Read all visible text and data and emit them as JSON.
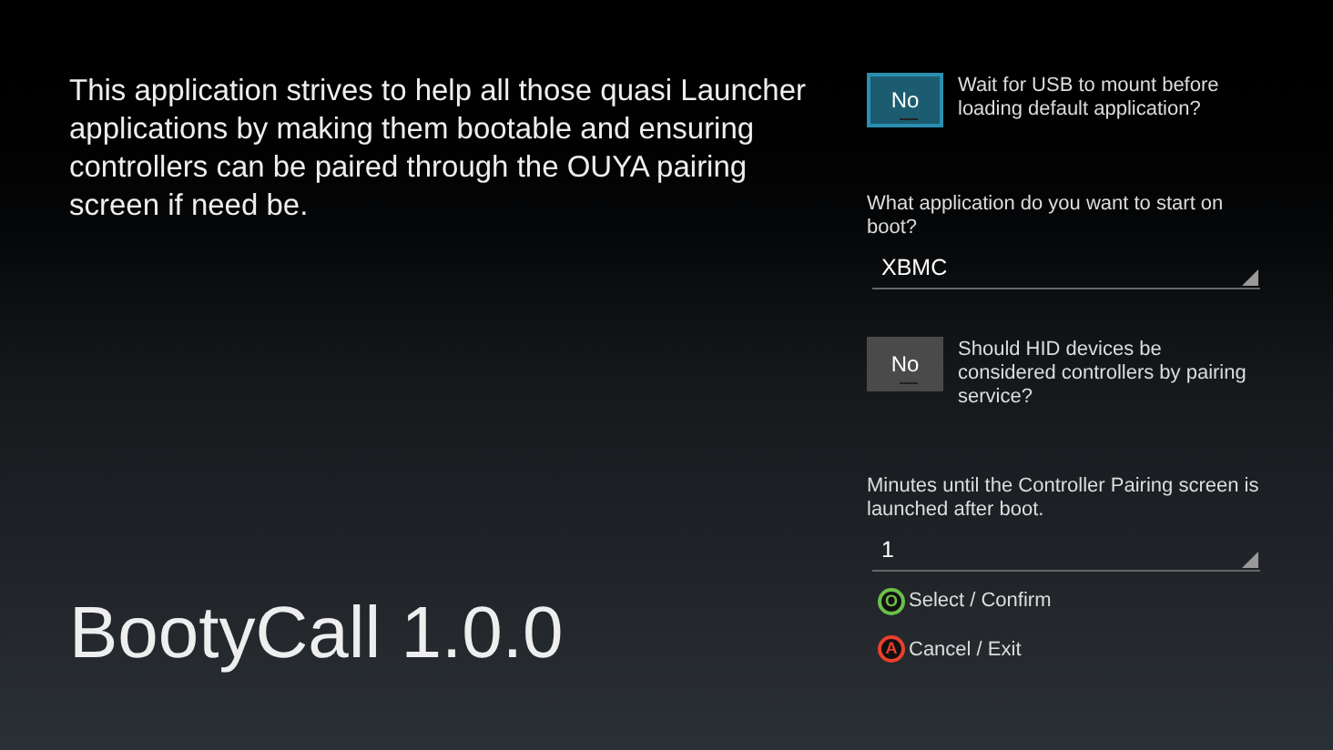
{
  "description": "This application strives to help all those quasi Launcher applications by making them bootable and ensuring controllers can be paired through the OUYA pairing screen if need be.",
  "app_title": "BootyCall 1.0.0",
  "settings": [
    {
      "kind": "toggle",
      "label": "No",
      "text": "Wait for USB to mount before loading default application?",
      "focused": true
    },
    {
      "kind": "dropdown",
      "text": "What application do you want to start on boot?",
      "value": "XBMC"
    },
    {
      "kind": "toggle",
      "label": "No",
      "text": "Should HID devices be considered controllers by pairing service?",
      "focused": false
    },
    {
      "kind": "dropdown",
      "text": "Minutes until the Controller Pairing screen is launched after boot.",
      "value": "1"
    }
  ],
  "hints": [
    {
      "key": "O",
      "label": "Select / Confirm",
      "color": "#6cc04a"
    },
    {
      "key": "A",
      "label": "Cancel / Exit",
      "color": "#e8412c"
    }
  ]
}
